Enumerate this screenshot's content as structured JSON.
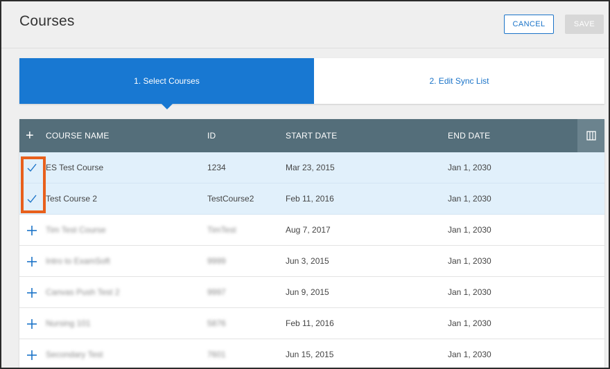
{
  "header": {
    "title": "Courses",
    "cancel_label": "CANCEL",
    "save_label": "SAVE"
  },
  "steps": [
    {
      "label": "1. Select Courses",
      "active": true
    },
    {
      "label": "2. Edit Sync List",
      "active": false
    }
  ],
  "table": {
    "columns": {
      "add": "+",
      "name": "COURSE NAME",
      "id": "ID",
      "start": "START DATE",
      "end": "END DATE"
    },
    "rows": [
      {
        "selected": true,
        "icon": "checkmark-icon",
        "name": "ES Test Course",
        "id": "1234",
        "start": "Mar 23, 2015",
        "end": "Jan 1, 2030",
        "blurred": false
      },
      {
        "selected": true,
        "icon": "checkmark-icon",
        "name": "Test Course 2",
        "id": "TestCourse2",
        "start": "Feb 11, 2016",
        "end": "Jan 1, 2030",
        "blurred": false
      },
      {
        "selected": false,
        "icon": "plus-icon",
        "name": "Tim Test Course",
        "id": "TimTest",
        "start": "Aug 7, 2017",
        "end": "Jan 1, 2030",
        "blurred": true
      },
      {
        "selected": false,
        "icon": "plus-icon",
        "name": "Intro to ExamSoft",
        "id": "9999",
        "start": "Jun 3, 2015",
        "end": "Jan 1, 2030",
        "blurred": true
      },
      {
        "selected": false,
        "icon": "plus-icon",
        "name": "Canvas Push Test 2",
        "id": "9997",
        "start": "Jun 9, 2015",
        "end": "Jan 1, 2030",
        "blurred": true
      },
      {
        "selected": false,
        "icon": "plus-icon",
        "name": "Nursing 101",
        "id": "5876",
        "start": "Feb 11, 2016",
        "end": "Jan 1, 2030",
        "blurred": true
      },
      {
        "selected": false,
        "icon": "plus-icon",
        "name": "Secondary Test",
        "id": "7601",
        "start": "Jun 15, 2015",
        "end": "Jan 1, 2030",
        "blurred": true
      }
    ]
  },
  "colors": {
    "accent": "#1878d2",
    "header_bg": "#546e7a",
    "selected_row": "#e1f0fb",
    "highlight": "#e8601c"
  }
}
